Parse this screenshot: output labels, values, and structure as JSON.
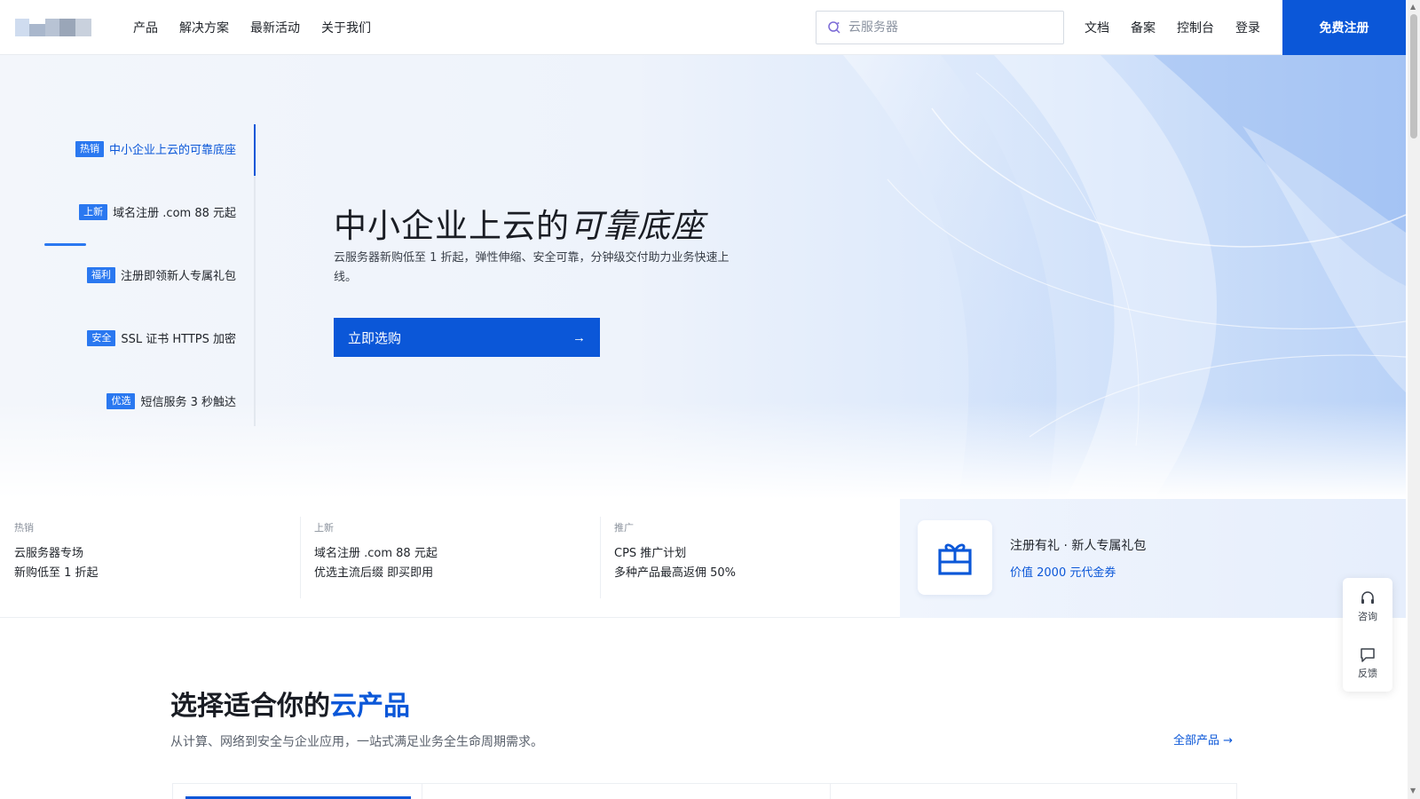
{
  "header": {
    "nav": [
      "产品",
      "解决方案",
      "最新活动",
      "关于我们"
    ],
    "search_placeholder": "云服务器",
    "links": [
      "文档",
      "备案",
      "控制台",
      "登录"
    ],
    "register": "免费注册"
  },
  "hero": {
    "tabs": [
      {
        "tag": "热销",
        "label": "中小企业上云的可靠底座",
        "active": true
      },
      {
        "tag": "上新",
        "label": "域名注册 .com 88 元起"
      },
      {
        "tag": "福利",
        "label": "注册即领新人专属礼包"
      },
      {
        "tag": "安全",
        "label": "SSL 证书 HTTPS 加密"
      },
      {
        "tag": "优选",
        "label": "短信服务 3 秒触达"
      }
    ],
    "title_plain": "中小企业上云的",
    "title_em": "可靠底座",
    "desc": "云服务器新购低至 1 折起，弹性伸缩、安全可靠，分钟级交付助力业务快速上线。",
    "button": "立即选购",
    "button_arrow": "→"
  },
  "promos": [
    {
      "tag": "热销",
      "line1": "云服务器专场",
      "line2": "新购低至 1 折起"
    },
    {
      "tag": "上新",
      "line1": "域名注册 .com 88 元起",
      "line2": "优选主流后缀 即买即用"
    },
    {
      "tag": "推广",
      "line1": "CPS 推广计划",
      "line2": "多种产品最高返佣 50%"
    }
  ],
  "gift": {
    "title": "注册有礼 · 新人专属礼包",
    "link": "价值 2000 元代金券"
  },
  "float_widget": {
    "consult": "咨询",
    "feedback": "反馈"
  },
  "products": {
    "title_plain": "选择适合你的",
    "title_accent": "云产品",
    "desc": "从计算、网络到安全与企业应用，一站式满足业务全生命周期需求。",
    "all_link": "全部产品 →"
  },
  "colors": {
    "accent": "#0b57d8",
    "tag": "#2a78f0"
  }
}
